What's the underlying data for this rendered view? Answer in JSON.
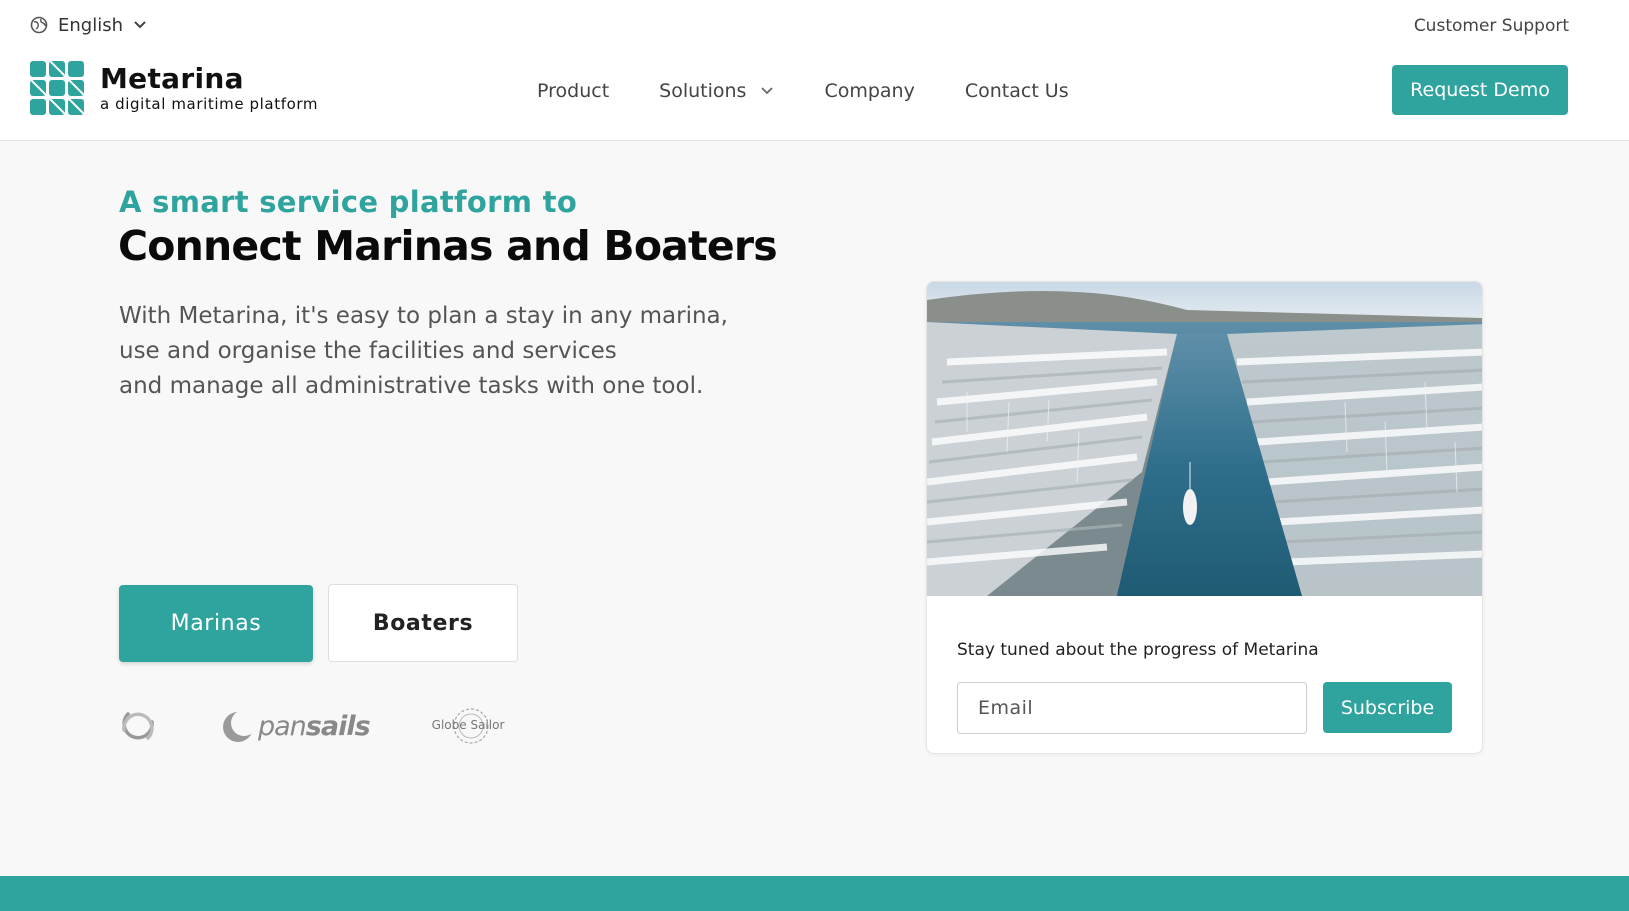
{
  "header": {
    "language": "English",
    "customer_support": "Customer Support",
    "logo_name": "Metarina",
    "logo_tagline": "a digital maritime platform",
    "nav": [
      "Product",
      "Solutions",
      "Company",
      "Contact Us"
    ],
    "request_demo": "Request Demo"
  },
  "hero": {
    "kicker": "A smart service platform to",
    "headline": "Connect Marinas and Boaters",
    "description": [
      "With Metarina, it's easy to plan a stay in any marina,",
      "use and organise the facilities and services",
      "and manage all administrative tasks with one tool."
    ],
    "btn_marinas": "Marinas",
    "btn_boaters": "Boaters",
    "partners": {
      "pansails_a": "pan",
      "pansails_b": "sails",
      "globe_sailor": "Globe Sailor"
    }
  },
  "subscribe_card": {
    "label": "Stay tuned about the progress of Metarina",
    "email_placeholder": "Email",
    "subscribe": "Subscribe"
  },
  "colors": {
    "brand": "#2fa49e"
  }
}
